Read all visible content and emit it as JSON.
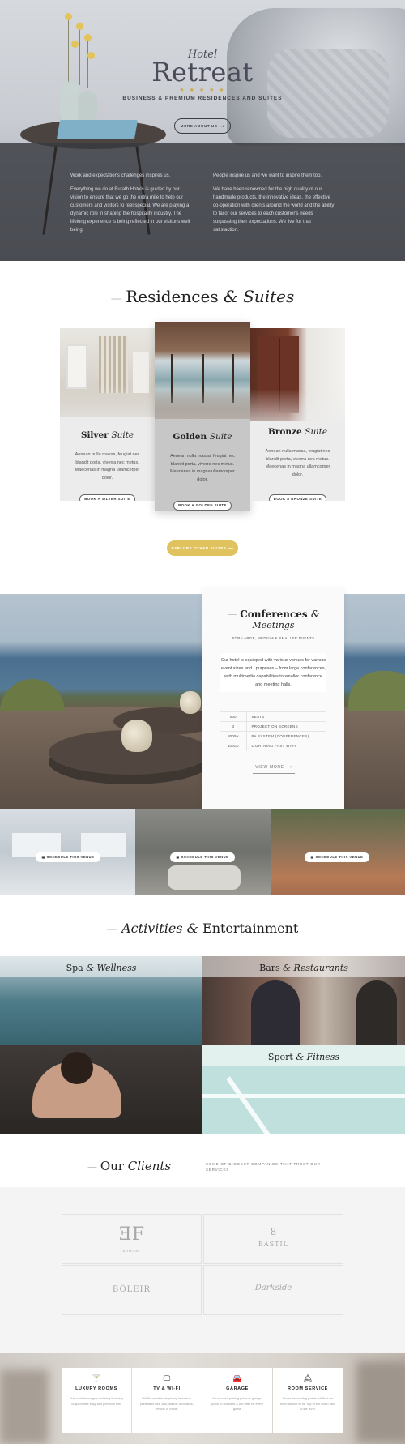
{
  "hero": {
    "hotel_small": "Hotel",
    "hotel_big": "Retreat",
    "stars": "★ ★ ★ ★ ★",
    "tagline": "BUSINESS & PREMIUM RESIDENCES AND SUITES",
    "more_button": "MORE ABOUT US  ⟶",
    "left_col": {
      "p1": "Work and expectations challenges inspires us.",
      "p2": "Everything we do at Eurath Hotels is guided by our vision to ensure that we go the extra mile to help our customers and visitors to feel special. We are playing a dynamic role in shaping the hospitality industry. The lifelong experience is being reflected in our visitor's well being."
    },
    "right_col": {
      "p1": "People inspire us and we want to inspire them too.",
      "p2": "We have been renowned for the high quality of our handmade products, the innovative ideas, the effective co-operation with clients around the world and the ability to tailor our services to each customer's needs surpassing their expectations. We live for that satisfaction."
    }
  },
  "residences": {
    "title_a": "Residences",
    "title_amp": "&",
    "title_b": "Suites",
    "suites": [
      {
        "name": "Silver",
        "suffix": "Suite",
        "desc": "Aenean nulla massa, feugiat nec blandit porta, viverra nec metus. Maecenas in magna ullamcorper dolor.",
        "button": "BOOK A SILVER SUITE"
      },
      {
        "name": "Golden",
        "suffix": "Suite",
        "desc": "Aenean nulla massa, feugiat nec blandit porta, viverra nec metus. Maecenas in magna ullamcorper dolor.",
        "button": "BOOK A GOLDEN SUITE"
      },
      {
        "name": "Bronze",
        "suffix": "Suite",
        "desc": "Aenean nulla massa, feugiat nec blandit porta, viverra nec metus. Maecenas in magna ullamcorper dolor.",
        "button": "BOOK A BRONZE SUITE"
      }
    ],
    "explore_button": "EXPLORE OTHER SUITES  ⟶"
  },
  "conferences": {
    "title_a": "Conferences",
    "title_amp": "&",
    "title_b": "Meetings",
    "subtitle": "FOR LARGE, MEDIUM & SMALLER EVENTS",
    "lead": "Our hotel is equipped with various venues for various event sizes and / purposes – from large conferences, with multimedia capabilities to smaller conference and meeting halls.",
    "rows": [
      {
        "num": "800",
        "label": "SEATS"
      },
      {
        "num": "3",
        "label": "PROJECTION SCREENS"
      },
      {
        "num": "8000w",
        "label": "PA SYSTEM (CONFERENCES)"
      },
      {
        "num": "100Gb",
        "label": "LIGHTNING FAST WI-FI"
      }
    ],
    "view_more": "VIEW MORE  ⟶",
    "venue_buttons": [
      "SCHEDULE THIS VENUE",
      "SCHEDULE THIS VENUE",
      "SCHEDULE THIS VENUE"
    ]
  },
  "activities": {
    "title_a": "Activities",
    "title_amp": "&",
    "title_b": "Entertainment",
    "tiles": [
      {
        "a": "Spa",
        "amp": "&",
        "b": "Wellness"
      },
      {
        "a": "Bars",
        "amp": "&",
        "b": "Restaurants"
      },
      {
        "a": "Sport",
        "amp": "&",
        "b": "Fitness"
      }
    ]
  },
  "clients": {
    "title_a": "Our",
    "title_b": "Clients",
    "subtitle": "SOME OF BIGGEST COMPANIES THAT TRUST OUR SERVICES",
    "logos": [
      "ARMONI",
      "BASTIL",
      "BÖLEIR",
      "Darkside"
    ]
  },
  "amenities": [
    {
      "icon": "🍸",
      "name": "LUXURY ROOMS",
      "text": "Duis sodales magnis molliring illius lacy Suspendisse impy and premium feel."
    },
    {
      "icon": "🖵",
      "name": "TV & WI-FI",
      "text": "Hill the modern telephony, technical, preferable lobi, and, liabelle & instanta, remote or mode."
    },
    {
      "icon": "🚘",
      "name": "GARAGE",
      "text": "No secured parking place or garage, place to standard & our offer for every guest."
    },
    {
      "icon": "🛎",
      "name": "ROOM SERVICE",
      "text": "Room demanding guests will find our room service to be \"top of the notch\" and at the level."
    }
  ]
}
